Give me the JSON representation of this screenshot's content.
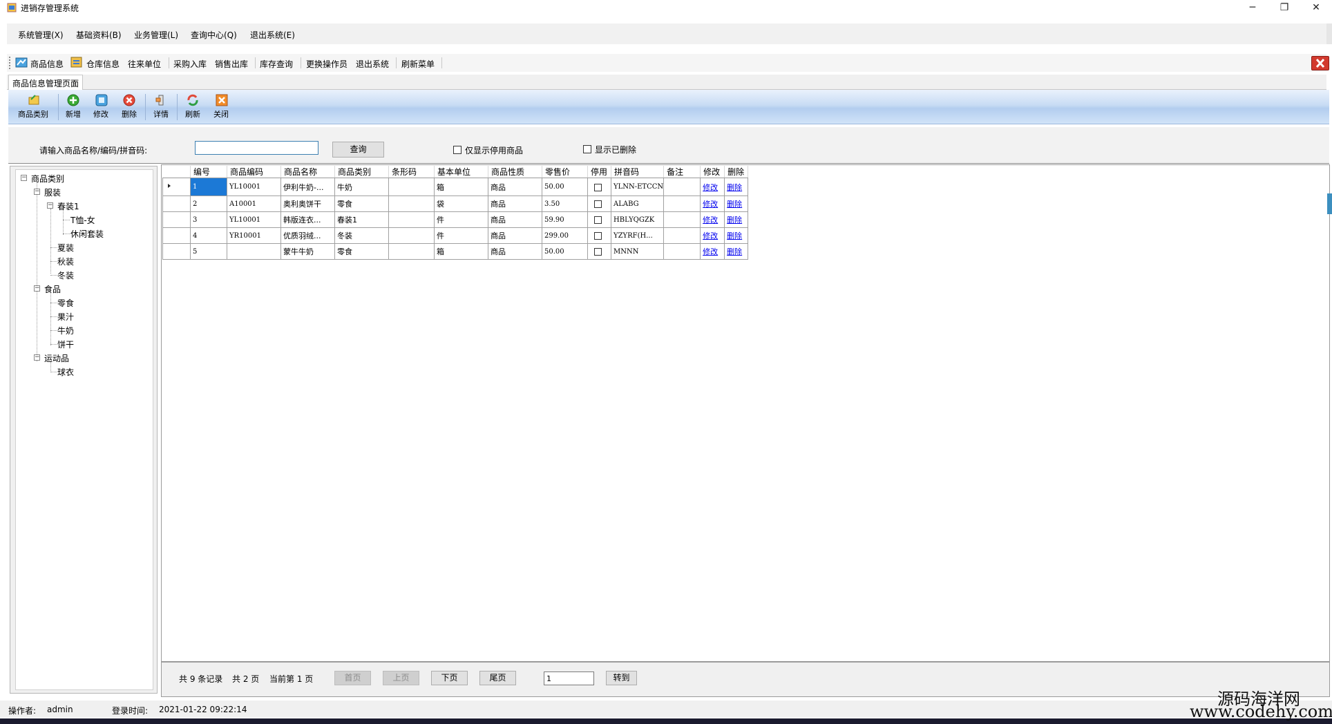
{
  "window": {
    "title": "进销存管理系统",
    "controls": {
      "minimize": "─",
      "restore": "❐",
      "close": "✕"
    }
  },
  "menu": {
    "items": [
      "系统管理(X)",
      "基础资料(B)",
      "业务管理(L)",
      "查询中心(Q)",
      "退出系统(E)"
    ]
  },
  "toolbar": {
    "items": [
      "商品信息",
      "仓库信息",
      "往来单位",
      "采购入库",
      "销售出库",
      "库存查询",
      "更换操作员",
      "退出系统",
      "刷新菜单"
    ],
    "close_icon": "red-x-icon"
  },
  "tab": {
    "label": "商品信息管理页面"
  },
  "ribbon": {
    "buttons": [
      {
        "label": "商品类别",
        "icon": "folder-icon"
      },
      {
        "label": "新增",
        "icon": "add-icon"
      },
      {
        "label": "修改",
        "icon": "edit-icon"
      },
      {
        "label": "删除",
        "icon": "delete-icon"
      },
      {
        "label": "详情",
        "icon": "details-icon"
      },
      {
        "label": "刷新",
        "icon": "refresh-icon"
      },
      {
        "label": "关闭",
        "icon": "close-icon"
      }
    ]
  },
  "search": {
    "label": "请输入商品名称/编码/拼音码:",
    "value": "",
    "button": "查询",
    "only_disabled_label": "仅显示停用商品",
    "show_deleted_label": "显示已删除"
  },
  "tree": {
    "root": "商品类别",
    "nodes": {
      "clothing": "服装",
      "spring": "春装1",
      "tshirt": "T恤-女",
      "casual": "休闲套装",
      "summer": "夏装",
      "autumn": "秋装",
      "winter": "冬装",
      "food": "食品",
      "snack": "零食",
      "juice": "果汁",
      "milk": "牛奶",
      "biscuit": "饼干",
      "sports": "运动品",
      "jersey": "球衣"
    }
  },
  "grid": {
    "columns": [
      "编号",
      "商品编码",
      "商品名称",
      "商品类别",
      "条形码",
      "基本单位",
      "商品性质",
      "零售价",
      "停用",
      "拼音码",
      "备注",
      "修改",
      "删除"
    ],
    "rows": [
      {
        "id": "1",
        "code": "YL10001",
        "name": "伊利牛奶-...",
        "category": "牛奶",
        "barcode": "",
        "unit": "箱",
        "nature": "商品",
        "price": "50.00",
        "disabled": false,
        "pinyin": "YLNN-ETCCN",
        "remark": "",
        "edit": "修改",
        "delete": "删除"
      },
      {
        "id": "2",
        "code": "A10001",
        "name": "奥利奥饼干",
        "category": "零食",
        "barcode": "",
        "unit": "袋",
        "nature": "商品",
        "price": "3.50",
        "disabled": false,
        "pinyin": "ALABG",
        "remark": "",
        "edit": "修改",
        "delete": "删除"
      },
      {
        "id": "3",
        "code": "YL10001",
        "name": "韩版连衣...",
        "category": "春装1",
        "barcode": "",
        "unit": "件",
        "nature": "商品",
        "price": "59.90",
        "disabled": false,
        "pinyin": "HBLYQGZK",
        "remark": "",
        "edit": "修改",
        "delete": "删除"
      },
      {
        "id": "4",
        "code": "YR10001",
        "name": "优质羽绒...",
        "category": "冬装",
        "barcode": "",
        "unit": "件",
        "nature": "商品",
        "price": "299.00",
        "disabled": false,
        "pinyin": "YZYRF(H...",
        "remark": "",
        "edit": "修改",
        "delete": "删除"
      },
      {
        "id": "5",
        "code": "",
        "name": "蒙牛牛奶",
        "category": "零食",
        "barcode": "",
        "unit": "箱",
        "nature": "商品",
        "price": "50.00",
        "disabled": false,
        "pinyin": "MNNN",
        "remark": "",
        "edit": "修改",
        "delete": "删除"
      }
    ]
  },
  "pager": {
    "total_records": "共 9 条记录",
    "total_pages": "共 2 页",
    "current_page": "当前第 1 页",
    "first": "首页",
    "prev": "上页",
    "next": "下页",
    "last": "尾页",
    "goto_value": "1",
    "goto": "转到"
  },
  "status": {
    "operator_label": "操作者:",
    "operator": "admin",
    "login_label": "登录时间:",
    "login_time": "2021-01-22 09:22:14"
  },
  "watermark": {
    "line1": "源码海洋网",
    "line2": "www.codehy.com"
  }
}
